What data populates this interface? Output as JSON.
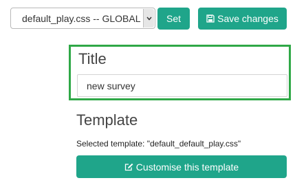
{
  "template_select": {
    "selected": "default_play.css -- GLOBAL"
  },
  "buttons": {
    "set_label": "Set",
    "save_label": "Save changes",
    "customise_label": "Customise this template"
  },
  "icons": {
    "select_arrow": "chevron-down-icon",
    "save": "floppy-disk-icon",
    "customise": "edit-icon"
  },
  "title_section": {
    "heading": "Title",
    "input_value": "new survey"
  },
  "template_section": {
    "heading": "Template",
    "selected_text": "Selected template: \"default_default_play.css\""
  },
  "colors": {
    "button_bg": "#1fa58a",
    "highlight_border": "#2fa847"
  }
}
